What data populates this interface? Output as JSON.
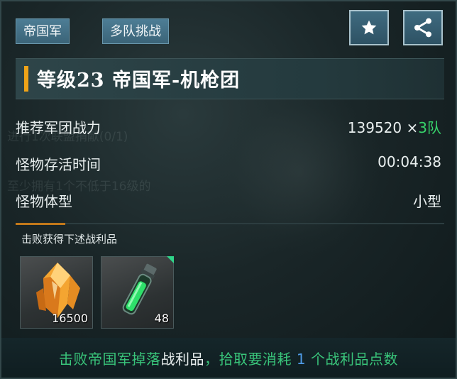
{
  "header": {
    "tag_faction": "帝国军",
    "tag_mode": "多队挑战",
    "favorite_icon": "star-icon",
    "share_icon": "share-icon"
  },
  "title": {
    "text": "等级23  帝国军-机枪团",
    "accent_color": "#f0a418"
  },
  "stats": {
    "power_label": "推荐军团战力",
    "power_value": "139520",
    "power_multiplier": "×",
    "power_teams": "3队",
    "survival_label": "怪物存活时间",
    "survival_value": "00:04:38",
    "size_label": "怪物体型",
    "size_value": "小型"
  },
  "loot": {
    "label": "击败获得下述战利品",
    "items": [
      {
        "icon": "amber-crystal-icon",
        "count": "16500"
      },
      {
        "icon": "green-vial-icon",
        "count": "48"
      }
    ]
  },
  "footer": {
    "part1": "击败帝国军掉落",
    "part2": "战利品",
    "part3": "，拾取要消耗 ",
    "part4": "1",
    "part5": " 个战利品点数"
  },
  "background_ghost": {
    "line1": "进行1次联盟捐献(0/1)",
    "line2": "至少拥有1个不低于16级的"
  },
  "colors": {
    "highlight_green": "#37d36b",
    "footer_green": "#39c47a",
    "footer_blue": "#4f9be6",
    "tag_blue": "#4d7d95"
  }
}
